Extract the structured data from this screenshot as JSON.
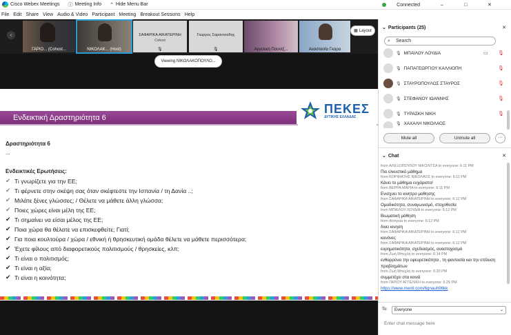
{
  "titlebar": {
    "app_name": "Cisco Webex Meetings",
    "meeting_info": "Meeting Info",
    "hide_menu_bar": "Hide Menu Bar",
    "hide_chevron": "⌃",
    "status": "Connected",
    "min": "–",
    "max": "□",
    "close": "✕"
  },
  "menubar": {
    "items": [
      "File",
      "Edit",
      "Share",
      "View",
      "Audio & Video",
      "Participant",
      "Meeting",
      "Breakout Sessions",
      "Help"
    ]
  },
  "stage": {
    "prev": "‹",
    "next": "›",
    "tiles": [
      {
        "name": "ΓΑΡΙΟ... (Cohost...",
        "sub": ""
      },
      {
        "name": "ΝΙΚΟΛΑΚ... (Host)",
        "sub": ""
      },
      {
        "name": "ΣΑΦΑΡΙΚΑ ΑΙΚΑΤΕΡΙΝΗ",
        "sub": "Cohost"
      },
      {
        "name": "Γιώργος Σαραντούδης",
        "sub": ""
      },
      {
        "name": "Αγγελική Πουντζ...",
        "sub": ""
      },
      {
        "name": "Αναστασία Γκαρα",
        "sub": ""
      }
    ],
    "layout_label": "Layout",
    "viewing": "Viewing ΝΙΚΟΛΑΚΟΠΟΥΛΟ..."
  },
  "slide": {
    "banner": "Ενδεικτική Δραστηριότητα 6",
    "logo_name": "ΠΕΚΕΣ",
    "logo_region": "ΔΥΤΙΚΗΣ ΕΛΛΑΔΑΣ",
    "heading": "Δραστηριότητα 6",
    "ellipsis": "...",
    "subheading": "Ενδεικτικές Ερωτήσεις:",
    "check_glyph": "✔",
    "questions": [
      "Τι γνωρίζετε για την ΕΕ;",
      "Τι φέρνετε στην σκέψη σας όταν σκέφτεστε την Ισπανία / τη Δανία ..;",
      "Μιλάτε ξένες γλώσσες; / Θέλετε να μάθετε άλλη γλώσσα;",
      "Ποιες χώρες είναι μέλη της ΕΕ;",
      "Τι σημαίνει να είσαι μέλος της ΕΕ;",
      "Ποια χώρα θα θέλατε να επισκεφθείτε; Γιατί;",
      "Για ποια κουλτούρα / χώρα / εθνική ή θρησκευτική ομάδα θέλετε να μάθετε περισσότερα;",
      "Έχετε φίλους από διαφορετικούς πολιτισμούς / θρησκείες, κλπ;",
      "Τι είναι ο πολιτισμός;",
      "Τι είναι η αξία;",
      "Τι είναι η κοινότητα;"
    ]
  },
  "participants": {
    "title": "Participants (25)",
    "collapse": "⌄",
    "close": "✕",
    "search_icon": "⌕",
    "search_placeholder": "Search",
    "mic_glyph": "🎙",
    "video_glyph": "▭",
    "mute_glyph": "🎙",
    "list": [
      {
        "name": "ΜΠΑΙΛΟΥ ΛΟΥΔΙΑ",
        "video": true
      },
      {
        "name": "ΠΑΠΑΓΕΩΡΓΙΟΥ ΚΑΛΛΙΟΠΗ",
        "video": false
      },
      {
        "name": "ΣΤΑΥΡΟΠΟΥΛΟΣ ΣΤΑΥΡΟΣ",
        "video": false
      },
      {
        "name": "ΣΤΕΦΑΝΟΥ ΙΩΑΝΝΗΣ",
        "video": false
      },
      {
        "name": "ΤΥΡΑΣΚΗ ΝΙΚΗ",
        "video": false
      },
      {
        "name": "ΧΑΧΑΛΗ ΝΙΚΟΛΑΟΣ",
        "video": false
      }
    ],
    "mute_all": "Mute all",
    "unmute_all": "Unmute all",
    "more": "···"
  },
  "chat": {
    "title": "Chat",
    "collapse": "⌄",
    "close": "✕",
    "messages": [
      {
        "meta": "from ΑΛΕΞΟΠΟΥΛΟΥ ΝΙΚΟΛΙΤΣΑ to everyone:    6:11 PM",
        "text": "Πιο ελκυστικό μάθημα"
      },
      {
        "meta": "from ΚΟΡΦΙΑΤΗΣ ΝΙΚΟΛΑΟΣ to everyone:    6:11 PM",
        "text": "Κάνει το μάθημα ευχάριστο!"
      },
      {
        "meta": "from ΒΕΡΡΑ ΜΑΡΙΑ to everyone:    6:11 PM",
        "text": "Ενισχυει το κινητρο μαθησης"
      },
      {
        "meta": "from ΣΑΦΑΡΙΚΑ ΑΙΚΑΤΕΡΙΝΗ to everyone:    6:12 PM",
        "text": "Ομαδικότητα, συναγωνισμό, στοχοθεσία"
      },
      {
        "meta": "from ΜΠΑΙΛΟΥ ΛΟΥΔΙΑ to everyone:    6:12 PM",
        "text": "Βιωματική μάθηση"
      },
      {
        "meta": "from dionysia to everyone:    6:12 PM",
        "text": "δινει  κινηση"
      },
      {
        "meta": "from ΣΑΦΑΡΙΚΑ ΑΙΚΑΤΕΡΙΝΗ to everyone:    6:12 PM",
        "text": "κανόνες"
      },
      {
        "meta": "from ΣΑΦΑΡΙΚΑ ΑΙΚΑΤΕΡΙΝΗ to everyone:    6:12 PM",
        "text": "ευρηματικότητα, σχεδιασμός, αναστοχασμό"
      },
      {
        "meta": "from Ζωή Μπεχλή to everyone:    6:14 PM",
        "text": "ενθαρρύνει την εφευρετικότητα , τη φαντασία και την επίλυση προβλημάτων"
      },
      {
        "meta": "from Ζωή Μπεχλή to everyone:    6:20 PM",
        "text": "συμμετέχει στα κοινά"
      },
      {
        "meta": "from ΓΑΡΙΟΥ ΑΓΓΕΛΙΚΗ to everyone:    6:25 PM",
        "text": "https://www.menti.com/6gnauh96kk",
        "link": true
      }
    ],
    "to_label": "To:",
    "to_value": "Everyone",
    "to_chevron": "⌄",
    "input_placeholder": "Enter chat message here"
  }
}
